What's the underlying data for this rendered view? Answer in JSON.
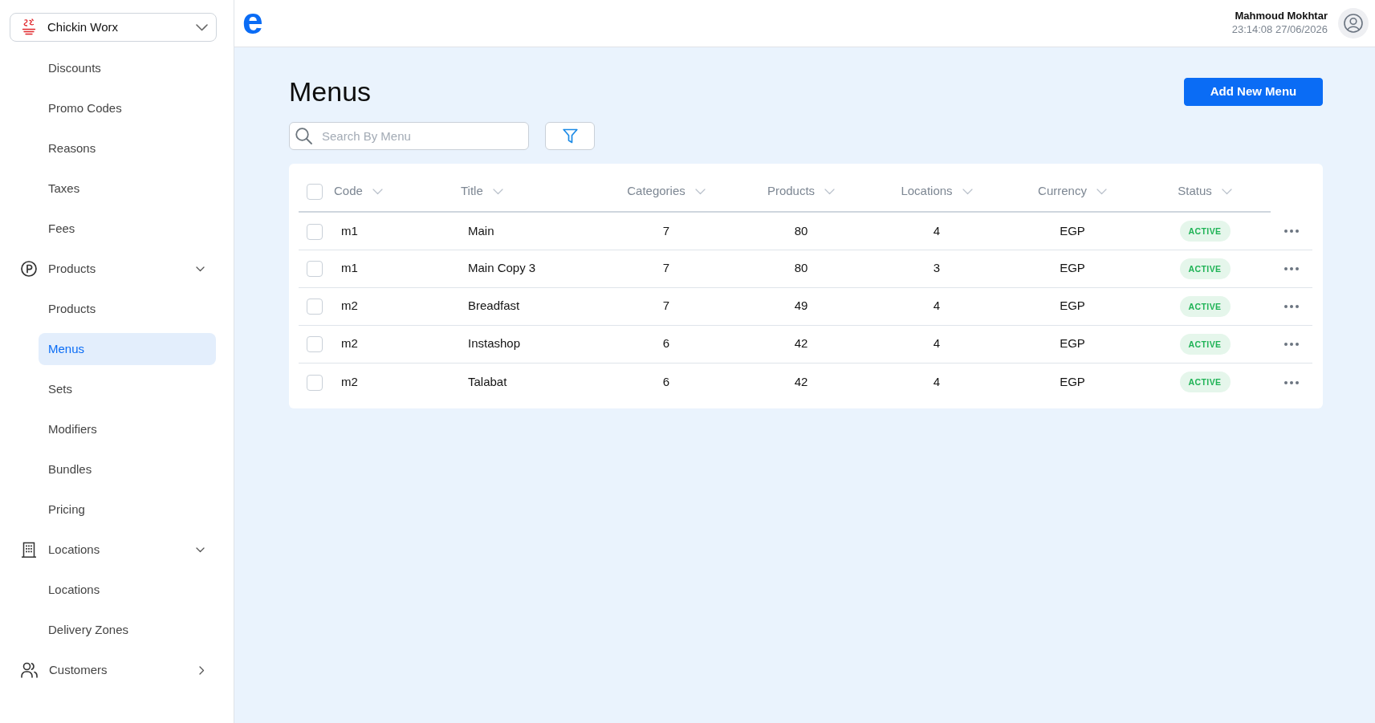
{
  "sidebar": {
    "brand_selector": {
      "label": "Chickin Worx"
    },
    "items": [
      {
        "kind": "link",
        "label": "Discounts",
        "selected": false
      },
      {
        "kind": "link",
        "label": "Promo Codes",
        "selected": false
      },
      {
        "kind": "link",
        "label": "Reasons",
        "selected": false
      },
      {
        "kind": "link",
        "label": "Taxes",
        "selected": false
      },
      {
        "kind": "link",
        "label": "Fees",
        "selected": false
      },
      {
        "kind": "group",
        "label": "Products",
        "expanded": true,
        "children": [
          {
            "label": "Products",
            "selected": false
          },
          {
            "label": "Menus",
            "selected": true
          },
          {
            "label": "Sets",
            "selected": false
          },
          {
            "label": "Modifiers",
            "selected": false
          },
          {
            "label": "Bundles",
            "selected": false
          },
          {
            "label": "Pricing",
            "selected": false
          }
        ]
      },
      {
        "kind": "group",
        "label": "Locations",
        "expanded": true,
        "children": [
          {
            "label": "Locations",
            "selected": false
          },
          {
            "label": "Delivery Zones",
            "selected": false
          }
        ]
      },
      {
        "kind": "group",
        "label": "Customers",
        "expanded": false
      }
    ]
  },
  "header": {
    "logo": "e",
    "user": {
      "name": "Mahmoud Mokhtar",
      "datetime": "23:14:08 27/06/2026"
    }
  },
  "page": {
    "title": "Menus",
    "add_button": "Add New Menu",
    "search": {
      "placeholder": "Search By Menu"
    }
  },
  "table": {
    "select_all": {
      "checked": false
    },
    "columns": [
      {
        "label": "Code",
        "kind": "text"
      },
      {
        "label": "Title",
        "kind": "text"
      },
      {
        "label": "Categories",
        "kind": "number"
      },
      {
        "label": "Products",
        "kind": "number"
      },
      {
        "label": "Locations",
        "kind": "number"
      },
      {
        "label": "Currency",
        "kind": "number"
      },
      {
        "label": "Status",
        "kind": "badge"
      }
    ],
    "rows": [
      {
        "checked": false,
        "cells": [
          "m1",
          "Main",
          "7",
          "80",
          "4",
          "EGP",
          "ACTIVE"
        ]
      },
      {
        "checked": false,
        "cells": [
          "m1",
          "Main Copy 3",
          "7",
          "80",
          "3",
          "EGP",
          "ACTIVE"
        ]
      },
      {
        "checked": false,
        "cells": [
          "m2",
          "Breadfast",
          "7",
          "49",
          "4",
          "EGP",
          "ACTIVE"
        ]
      },
      {
        "checked": false,
        "cells": [
          "m2",
          "Instashop",
          "6",
          "42",
          "4",
          "EGP",
          "ACTIVE"
        ]
      },
      {
        "checked": false,
        "cells": [
          "m2",
          "Talabat",
          "6",
          "42",
          "4",
          "EGP",
          "ACTIVE"
        ]
      }
    ]
  }
}
